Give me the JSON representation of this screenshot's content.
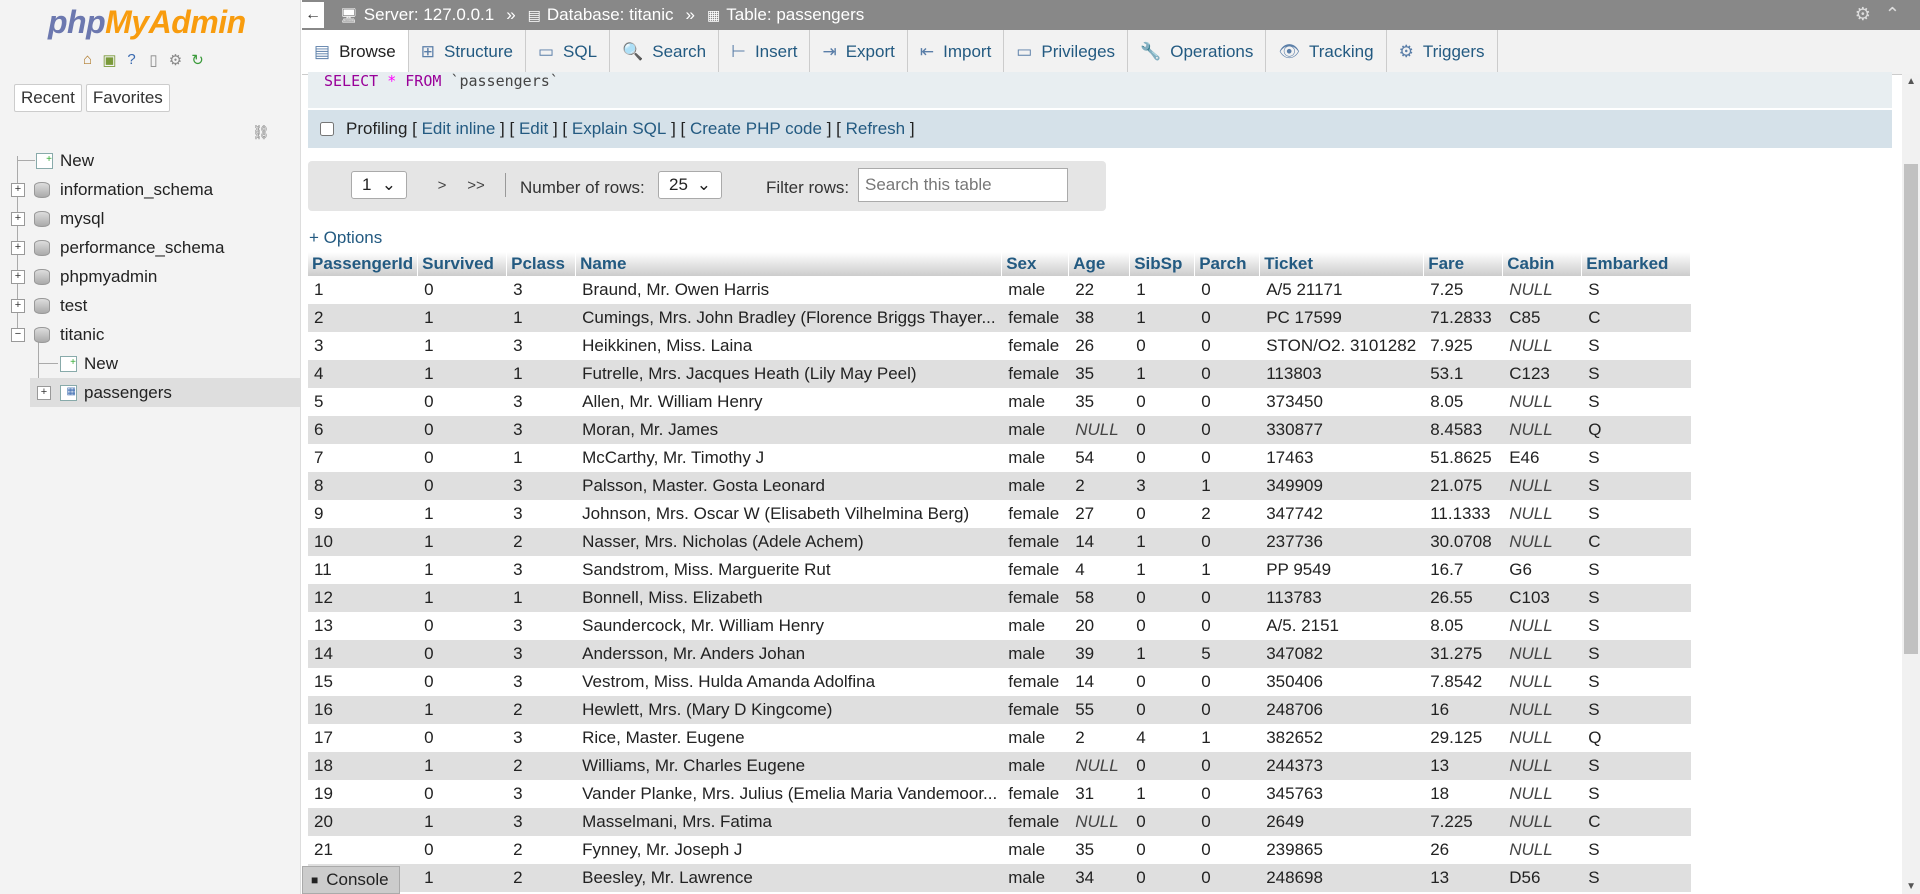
{
  "app": {
    "logo_php": "php",
    "logo_ma": "MyAdmin"
  },
  "nav": {
    "recent": "Recent",
    "favorites": "Favorites",
    "tree": [
      {
        "label": "New",
        "type": "new"
      },
      {
        "label": "information_schema",
        "type": "db"
      },
      {
        "label": "mysql",
        "type": "db"
      },
      {
        "label": "performance_schema",
        "type": "db"
      },
      {
        "label": "phpmyadmin",
        "type": "db"
      },
      {
        "label": "test",
        "type": "db"
      },
      {
        "label": "titanic",
        "type": "db-open"
      },
      {
        "label": "New",
        "type": "child-new"
      },
      {
        "label": "passengers",
        "type": "child-table"
      }
    ]
  },
  "breadcrumb": {
    "server": "Server: 127.0.0.1",
    "database": "Database: titanic",
    "table": "Table: passengers",
    "sep": "»"
  },
  "tabs": [
    "Browse",
    "Structure",
    "SQL",
    "Search",
    "Insert",
    "Export",
    "Import",
    "Privileges",
    "Operations",
    "Tracking",
    "Triggers"
  ],
  "sql": {
    "kw1": "SELECT",
    "star": "*",
    "kw2": "FROM",
    "table": "`passengers`"
  },
  "profiling": {
    "label": "Profiling",
    "edit_inline": "Edit inline",
    "edit": "Edit",
    "explain": "Explain SQL",
    "create_php": "Create PHP code",
    "refresh": "Refresh"
  },
  "controls": {
    "page": "1",
    "next": ">",
    "last": ">>",
    "rows_label": "Number of rows:",
    "rows": "25",
    "filter_label": "Filter rows:",
    "filter_placeholder": "Search this table"
  },
  "options_link": "+ Options",
  "table": {
    "columns": [
      "PassengerId",
      "Survived",
      "Pclass",
      "Name",
      "Sex",
      "Age",
      "SibSp",
      "Parch",
      "Ticket",
      "Fare",
      "Cabin",
      "Embarked"
    ],
    "rows": [
      [
        "1",
        "0",
        "3",
        "Braund, Mr. Owen Harris",
        "male",
        "22",
        "1",
        "0",
        "A/5 21171",
        "7.25",
        "NULL",
        "S"
      ],
      [
        "2",
        "1",
        "1",
        "Cumings, Mrs. John Bradley (Florence Briggs Thayer...",
        "female",
        "38",
        "1",
        "0",
        "PC 17599",
        "71.2833",
        "C85",
        "C"
      ],
      [
        "3",
        "1",
        "3",
        "Heikkinen, Miss. Laina",
        "female",
        "26",
        "0",
        "0",
        "STON/O2. 3101282",
        "7.925",
        "NULL",
        "S"
      ],
      [
        "4",
        "1",
        "1",
        "Futrelle, Mrs. Jacques Heath (Lily May Peel)",
        "female",
        "35",
        "1",
        "0",
        "113803",
        "53.1",
        "C123",
        "S"
      ],
      [
        "5",
        "0",
        "3",
        "Allen, Mr. William Henry",
        "male",
        "35",
        "0",
        "0",
        "373450",
        "8.05",
        "NULL",
        "S"
      ],
      [
        "6",
        "0",
        "3",
        "Moran, Mr. James",
        "male",
        "NULL",
        "0",
        "0",
        "330877",
        "8.4583",
        "NULL",
        "Q"
      ],
      [
        "7",
        "0",
        "1",
        "McCarthy, Mr. Timothy J",
        "male",
        "54",
        "0",
        "0",
        "17463",
        "51.8625",
        "E46",
        "S"
      ],
      [
        "8",
        "0",
        "3",
        "Palsson, Master. Gosta Leonard",
        "male",
        "2",
        "3",
        "1",
        "349909",
        "21.075",
        "NULL",
        "S"
      ],
      [
        "9",
        "1",
        "3",
        "Johnson, Mrs. Oscar W (Elisabeth Vilhelmina Berg)",
        "female",
        "27",
        "0",
        "2",
        "347742",
        "11.1333",
        "NULL",
        "S"
      ],
      [
        "10",
        "1",
        "2",
        "Nasser, Mrs. Nicholas (Adele Achem)",
        "female",
        "14",
        "1",
        "0",
        "237736",
        "30.0708",
        "NULL",
        "C"
      ],
      [
        "11",
        "1",
        "3",
        "Sandstrom, Miss. Marguerite Rut",
        "female",
        "4",
        "1",
        "1",
        "PP 9549",
        "16.7",
        "G6",
        "S"
      ],
      [
        "12",
        "1",
        "1",
        "Bonnell, Miss. Elizabeth",
        "female",
        "58",
        "0",
        "0",
        "113783",
        "26.55",
        "C103",
        "S"
      ],
      [
        "13",
        "0",
        "3",
        "Saundercock, Mr. William Henry",
        "male",
        "20",
        "0",
        "0",
        "A/5. 2151",
        "8.05",
        "NULL",
        "S"
      ],
      [
        "14",
        "0",
        "3",
        "Andersson, Mr. Anders Johan",
        "male",
        "39",
        "1",
        "5",
        "347082",
        "31.275",
        "NULL",
        "S"
      ],
      [
        "15",
        "0",
        "3",
        "Vestrom, Miss. Hulda Amanda Adolfina",
        "female",
        "14",
        "0",
        "0",
        "350406",
        "7.8542",
        "NULL",
        "S"
      ],
      [
        "16",
        "1",
        "2",
        "Hewlett, Mrs. (Mary D Kingcome)",
        "female",
        "55",
        "0",
        "0",
        "248706",
        "16",
        "NULL",
        "S"
      ],
      [
        "17",
        "0",
        "3",
        "Rice, Master. Eugene",
        "male",
        "2",
        "4",
        "1",
        "382652",
        "29.125",
        "NULL",
        "Q"
      ],
      [
        "18",
        "1",
        "2",
        "Williams, Mr. Charles Eugene",
        "male",
        "NULL",
        "0",
        "0",
        "244373",
        "13",
        "NULL",
        "S"
      ],
      [
        "19",
        "0",
        "3",
        "Vander Planke, Mrs. Julius (Emelia Maria Vandemoor...",
        "female",
        "31",
        "1",
        "0",
        "345763",
        "18",
        "NULL",
        "S"
      ],
      [
        "20",
        "1",
        "3",
        "Masselmani, Mrs. Fatima",
        "female",
        "NULL",
        "0",
        "0",
        "2649",
        "7.225",
        "NULL",
        "C"
      ],
      [
        "21",
        "0",
        "2",
        "Fynney, Mr. Joseph J",
        "male",
        "35",
        "0",
        "0",
        "239865",
        "26",
        "NULL",
        "S"
      ],
      [
        "22",
        "1",
        "2",
        "Beesley, Mr. Lawrence",
        "male",
        "34",
        "0",
        "0",
        "248698",
        "13",
        "D56",
        "S"
      ]
    ]
  },
  "console": "Console",
  "colors": {
    "link": "#235a81",
    "topbar": "#888888",
    "sqlbg": "#e8eef1",
    "profilebg": "#d5e1e9"
  }
}
